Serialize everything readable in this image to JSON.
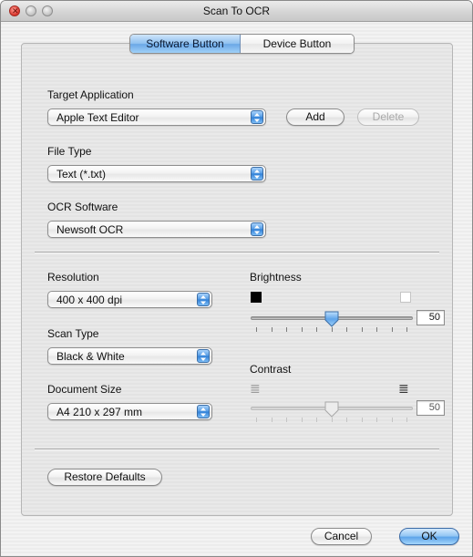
{
  "window": {
    "title": "Scan To OCR"
  },
  "tabs": [
    {
      "label": "Software Button",
      "selected": true
    },
    {
      "label": "Device Button",
      "selected": false
    }
  ],
  "target_application": {
    "label": "Target Application",
    "value": "Apple Text Editor",
    "add_label": "Add",
    "delete_label": "Delete"
  },
  "file_type": {
    "label": "File Type",
    "value": "Text (*.txt)"
  },
  "ocr_software": {
    "label": "OCR Software",
    "value": "Newsoft OCR"
  },
  "resolution": {
    "label": "Resolution",
    "value": "400 x 400 dpi"
  },
  "scan_type": {
    "label": "Scan Type",
    "value": "Black & White"
  },
  "document_size": {
    "label": "Document Size",
    "value": "A4 210 x 297 mm"
  },
  "brightness": {
    "label": "Brightness",
    "value": "50",
    "level": 0.5,
    "enabled": true
  },
  "contrast": {
    "label": "Contrast",
    "value": "50",
    "level": 0.5,
    "enabled": false
  },
  "restore_defaults_label": "Restore Defaults",
  "footer": {
    "cancel_label": "Cancel",
    "ok_label": "OK"
  },
  "colors": {
    "accent": "#6aa7e6",
    "window_bg": "#ececec"
  }
}
